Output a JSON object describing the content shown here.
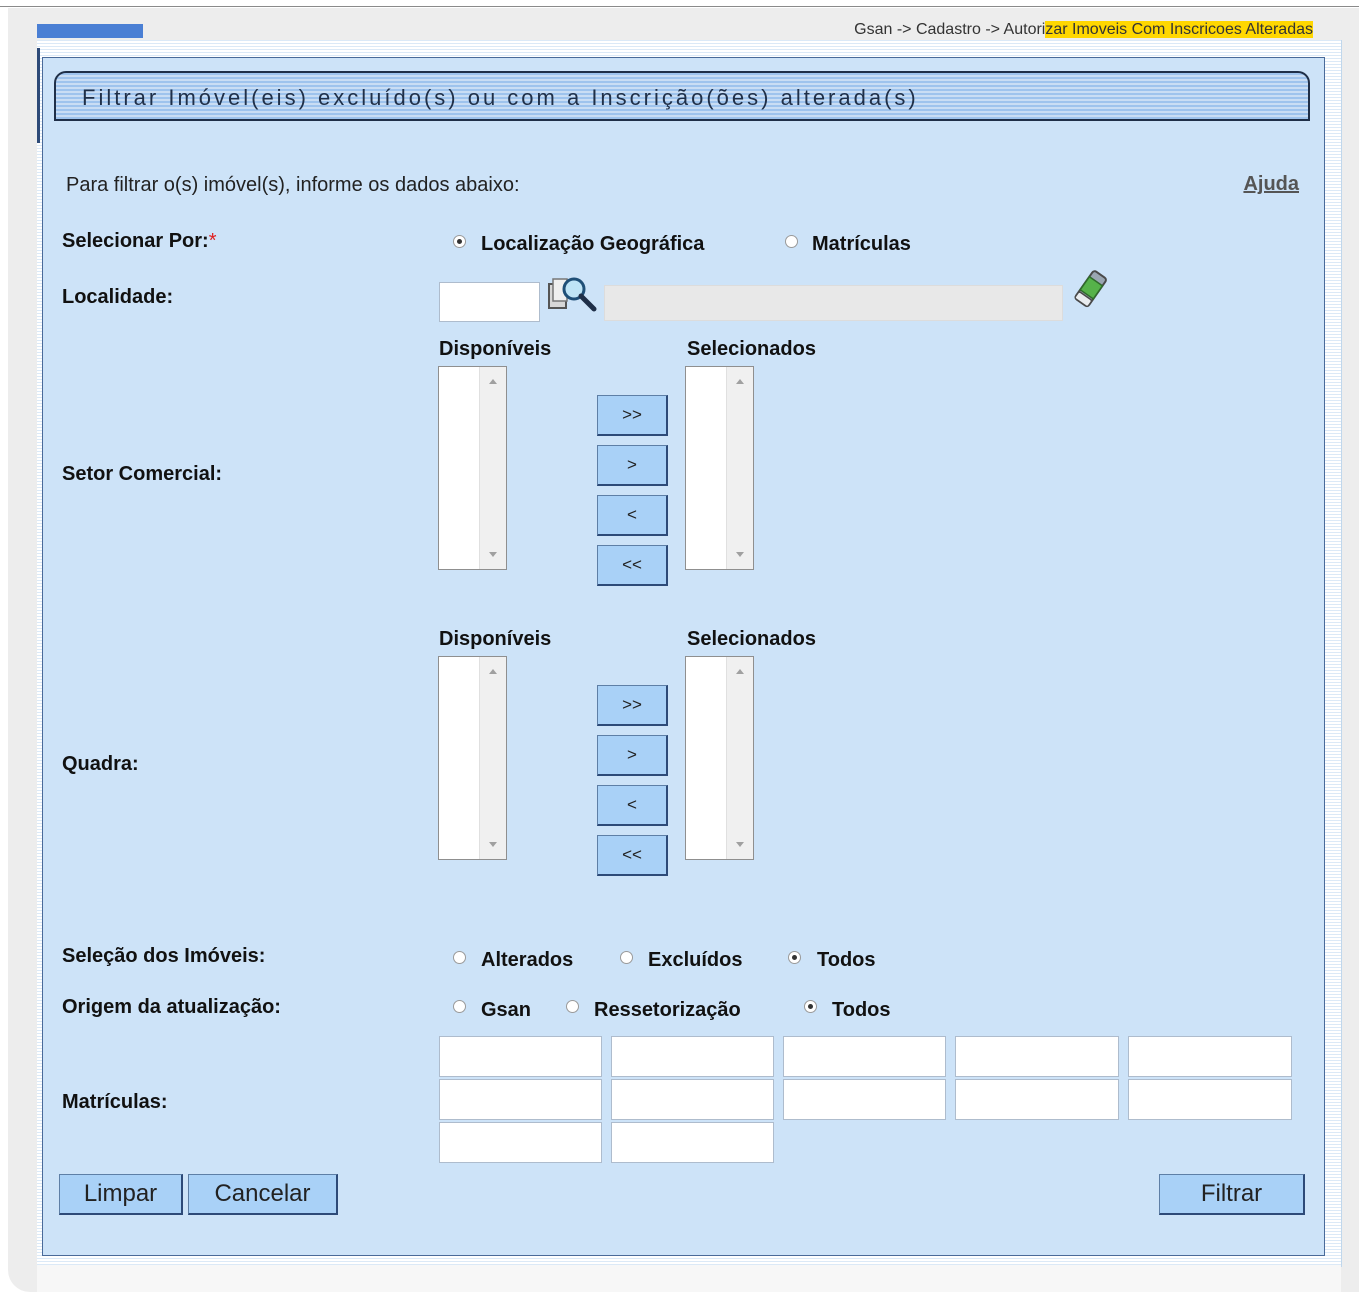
{
  "breadcrumb": {
    "prefix": "Gsan -> Cadastro -> Autori",
    "highlight": "zar Imoveis Com Inscricoes Alteradas"
  },
  "title": "Filtrar Imóvel(eis) excluído(s) ou com a Inscrição(ões) alterada(s)",
  "instructions": "Para filtrar o(s) imóvel(s), informe os dados abaixo:",
  "help_link": "Ajuda",
  "selecionar_por": {
    "label": "Selecionar Por:",
    "required_mark": "*",
    "options": [
      "Localização Geográfica",
      "Matrículas"
    ],
    "selected": "Localização Geográfica"
  },
  "localidade": {
    "label": "Localidade:",
    "code_value": "",
    "name_value": ""
  },
  "setor_comercial": {
    "label": "Setor Comercial:",
    "available_header": "Disponíveis",
    "selected_header": "Selecionados",
    "buttons": [
      ">>",
      ">",
      "<",
      "<<"
    ]
  },
  "quadra": {
    "label": "Quadra:",
    "available_header": "Disponíveis",
    "selected_header": "Selecionados",
    "buttons": [
      ">>",
      ">",
      "<",
      "<<"
    ]
  },
  "selecao_imoveis": {
    "label": "Seleção dos Imóveis:",
    "options": [
      "Alterados",
      "Excluídos",
      "Todos"
    ],
    "selected": "Todos"
  },
  "origem_atualizacao": {
    "label": "Origem da atualização:",
    "options": [
      "Gsan",
      "Ressetorização",
      "Todos"
    ],
    "selected": "Todos"
  },
  "matriculas": {
    "label": "Matrículas:",
    "values": [
      "",
      "",
      "",
      "",
      "",
      "",
      "",
      "",
      "",
      "",
      "",
      ""
    ]
  },
  "actions": {
    "limpar": "Limpar",
    "cancelar": "Cancelar",
    "filtrar": "Filtrar"
  },
  "colors": {
    "form_bg": "#cde3f8",
    "button_bg": "#a9d1f7",
    "highlight": "#ffd700"
  }
}
